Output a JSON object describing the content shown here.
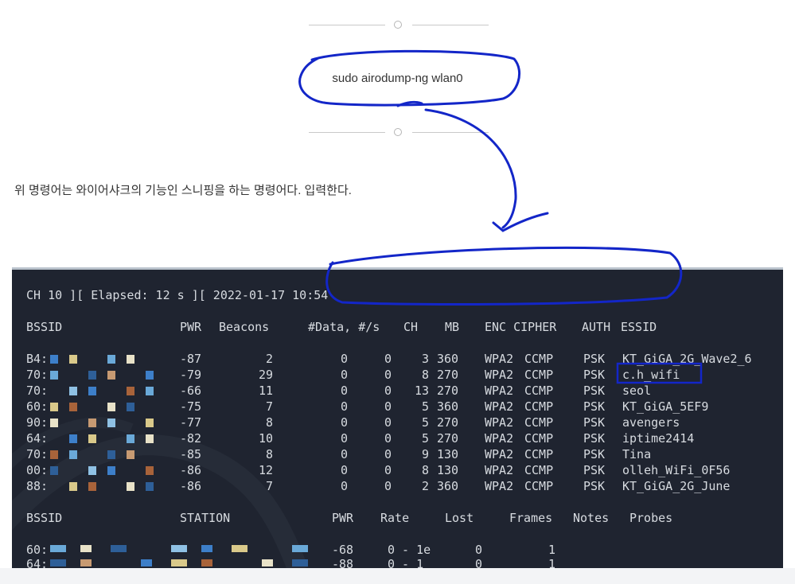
{
  "blog": {
    "command": "sudo airodump-ng wlan0",
    "description": "위 명령어는 와이어샤크의 기능인 스니핑을 하는 명령어다. 입력한다."
  },
  "terminal": {
    "status_line": "CH 10 ][ Elapsed: 12 s ][ 2022-01-17 10:54",
    "ap_headers": {
      "bssid": "BSSID",
      "pwr": "PWR",
      "beacons": "Beacons",
      "data": "#Data, #/s",
      "ch": "CH",
      "mb": "MB",
      "enc_cipher": "ENC CIPHER",
      "auth": "AUTH",
      "essid": "ESSID"
    },
    "ap_rows": [
      {
        "bssid": "B4:",
        "pwr": "-87",
        "beacons": "2",
        "data": "0",
        "rate": "0",
        "ch": "3",
        "mb": "360",
        "enc": "WPA2",
        "cipher": "CCMP",
        "auth": "PSK",
        "essid": "KT_GiGA_2G_Wave2_6"
      },
      {
        "bssid": "70:",
        "pwr": "-79",
        "beacons": "29",
        "data": "0",
        "rate": "0",
        "ch": "8",
        "mb": "270",
        "enc": "WPA2",
        "cipher": "CCMP",
        "auth": "PSK",
        "essid": "c.h_wifi"
      },
      {
        "bssid": "70:",
        "pwr": "-66",
        "beacons": "11",
        "data": "0",
        "rate": "0",
        "ch": "13",
        "mb": "270",
        "enc": "WPA2",
        "cipher": "CCMP",
        "auth": "PSK",
        "essid": "seol"
      },
      {
        "bssid": "60:",
        "pwr": "-75",
        "beacons": "7",
        "data": "0",
        "rate": "0",
        "ch": "5",
        "mb": "360",
        "enc": "WPA2",
        "cipher": "CCMP",
        "auth": "PSK",
        "essid": "KT_GiGA_5EF9"
      },
      {
        "bssid": "90:",
        "pwr": "-77",
        "beacons": "8",
        "data": "0",
        "rate": "0",
        "ch": "5",
        "mb": "270",
        "enc": "WPA2",
        "cipher": "CCMP",
        "auth": "PSK",
        "essid": "avengers"
      },
      {
        "bssid": "64:",
        "pwr": "-82",
        "beacons": "10",
        "data": "0",
        "rate": "0",
        "ch": "5",
        "mb": "270",
        "enc": "WPA2",
        "cipher": "CCMP",
        "auth": "PSK",
        "essid": "iptime2414"
      },
      {
        "bssid": "70:",
        "pwr": "-85",
        "beacons": "8",
        "data": "0",
        "rate": "0",
        "ch": "9",
        "mb": "130",
        "enc": "WPA2",
        "cipher": "CCMP",
        "auth": "PSK",
        "essid": "Tina"
      },
      {
        "bssid": "00:",
        "pwr": "-86",
        "beacons": "12",
        "data": "0",
        "rate": "0",
        "ch": "8",
        "mb": "130",
        "enc": "WPA2",
        "cipher": "CCMP",
        "auth": "PSK",
        "essid": "olleh_WiFi_0F56"
      },
      {
        "bssid": "88:",
        "pwr": "-86",
        "beacons": "7",
        "data": "0",
        "rate": "0",
        "ch": "2",
        "mb": "360",
        "enc": "WPA2",
        "cipher": "CCMP",
        "auth": "PSK",
        "essid": "KT_GiGA_2G_June"
      }
    ],
    "station_headers": {
      "bssid": "BSSID",
      "station": "STATION",
      "pwr": "PWR",
      "rate": "Rate",
      "lost": "Lost",
      "frames": "Frames",
      "notes": "Notes",
      "probes": "Probes"
    },
    "station_rows": [
      {
        "bssid": "60:",
        "pwr": "-68",
        "rate": "0 - 1e",
        "lost": "0",
        "frames": "1"
      },
      {
        "bssid": "64:",
        "pwr": "-88",
        "rate": "0 - 1",
        "lost": "0",
        "frames": "1"
      }
    ]
  },
  "colors": {
    "terminal_bg": "#1f2430",
    "annotation_pen": "#1326c8"
  }
}
